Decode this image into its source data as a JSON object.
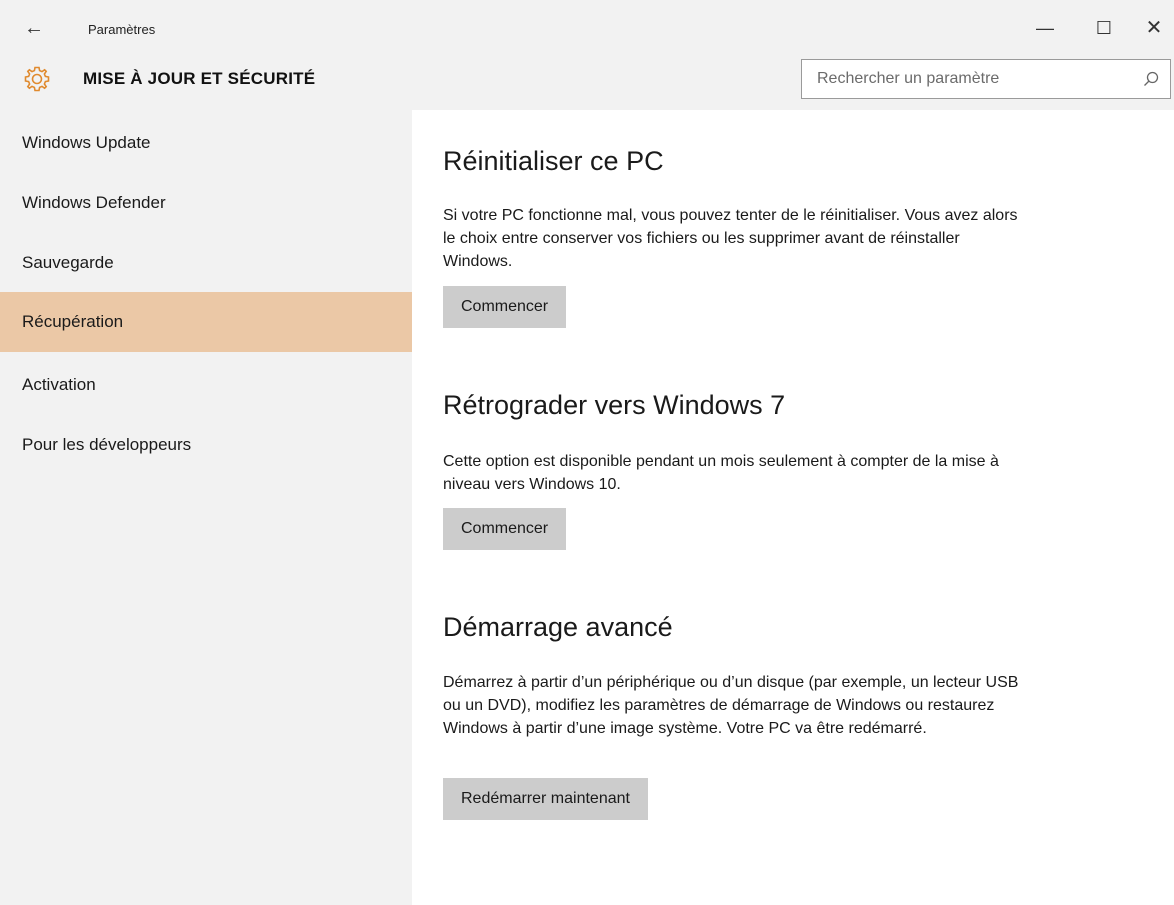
{
  "window": {
    "title": "Paramètres",
    "back_icon": "←",
    "minimize_icon": "—",
    "maximize_icon": "☐",
    "close_icon": "✕"
  },
  "header": {
    "title": "MISE À JOUR ET SÉCURITÉ",
    "icon": "gear-icon",
    "accent_color": "#e08a2e"
  },
  "search": {
    "placeholder": "Rechercher un paramètre",
    "icon": "search-icon"
  },
  "sidebar": {
    "items": [
      {
        "label": "Windows Update"
      },
      {
        "label": "Windows Defender"
      },
      {
        "label": "Sauvegarde"
      },
      {
        "label": "Récupération"
      },
      {
        "label": "Activation"
      },
      {
        "label": "Pour les développeurs"
      }
    ],
    "active_color": "#ebc8a6"
  },
  "main": {
    "sections": [
      {
        "title": "Réinitialiser ce PC",
        "description": "Si votre PC fonctionne mal, vous pouvez tenter de le réinitialiser. Vous avez alors le choix entre conserver vos fichiers ou les supprimer avant de réinstaller Windows.",
        "button": "Commencer"
      },
      {
        "title": "Rétrograder vers Windows 7",
        "description": "Cette option est disponible pendant un mois seulement à compter de la mise à niveau vers Windows 10.",
        "button": "Commencer"
      },
      {
        "title": "Démarrage avancé",
        "description": "Démarrez à partir d’un périphérique ou d’un disque (par exemple, un lecteur USB ou un DVD), modifiez les paramètres de démarrage de Windows ou restaurez Windows à partir d’une image système. Votre PC va être redémarré.",
        "button": "Redémarrer maintenant"
      }
    ]
  }
}
